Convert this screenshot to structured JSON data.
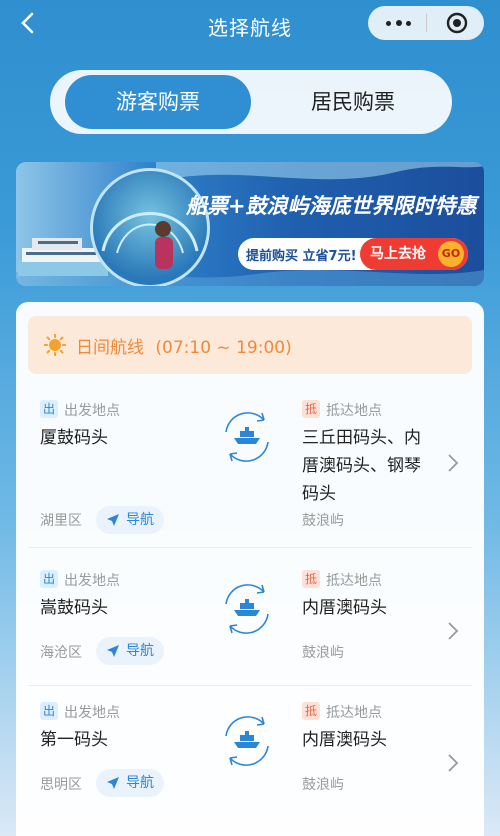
{
  "header": {
    "title": "选择航线",
    "back_icon": "back-chevron-icon",
    "more_icon": "more-dots-icon",
    "close_icon": "target-icon"
  },
  "tabs": [
    {
      "label": "游客购票",
      "active": true
    },
    {
      "label": "居民购票",
      "active": false
    }
  ],
  "banner": {
    "headline": "船票+鼓浪屿海底世界限时特惠",
    "subtext": "提前购买 立省7元!",
    "button_label": "马上去抢",
    "go_label": "GO"
  },
  "day_route": {
    "label": "日间航线",
    "hours": "(07:10 ~ 19:00)",
    "icon": "sun-icon"
  },
  "routes": [
    {
      "from_tag": "出",
      "from_label": "出发地点",
      "from_port": "厦鼓码头",
      "from_district": "湖里区",
      "nav_label": "导航",
      "to_tag": "抵",
      "to_label": "抵达地点",
      "to_port_lines": [
        "三丘田码头、内",
        "厝澳码头、钢琴",
        "码头"
      ],
      "to_district": "鼓浪屿"
    },
    {
      "from_tag": "出",
      "from_label": "出发地点",
      "from_port": "嵩鼓码头",
      "from_district": "海沧区",
      "nav_label": "导航",
      "to_tag": "抵",
      "to_label": "抵达地点",
      "to_port_lines": [
        "内厝澳码头"
      ],
      "to_district": "鼓浪屿"
    },
    {
      "from_tag": "出",
      "from_label": "出发地点",
      "from_port": "第一码头",
      "from_district": "思明区",
      "nav_label": "导航",
      "to_tag": "抵",
      "to_label": "抵达地点",
      "to_port_lines": [
        "内厝澳码头"
      ],
      "to_district": "鼓浪屿"
    }
  ],
  "colors": {
    "accent": "#2f8fd2",
    "day_bg": "#fce9d9",
    "day_text": "#f08a3a",
    "promo_red": "#ef3c32"
  }
}
